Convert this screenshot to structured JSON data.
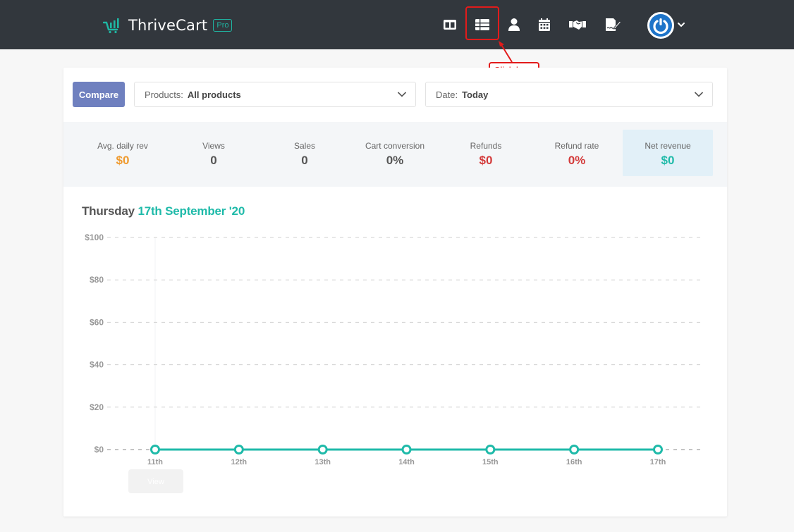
{
  "header": {
    "brand": "ThriveCart",
    "badge": "Pro",
    "nav_icons": [
      "columns-icon",
      "table-icon",
      "user-icon",
      "calendar-icon",
      "handshake-icon",
      "signature-icon"
    ],
    "colors": {
      "background": "#32373d",
      "accent": "#1fb6a3",
      "highlight": "#e21b1b"
    }
  },
  "callout": {
    "text": "Click here"
  },
  "filters": {
    "compare_label": "Compare",
    "products_label": "Products:",
    "products_value": "All products",
    "date_label": "Date:",
    "date_value": "Today"
  },
  "stats": [
    {
      "label": "Avg. daily rev",
      "value": "$0",
      "color": "#ef9a2e"
    },
    {
      "label": "Views",
      "value": "0",
      "color": "#555555"
    },
    {
      "label": "Sales",
      "value": "0",
      "color": "#555555"
    },
    {
      "label": "Cart conversion",
      "value": "0%",
      "color": "#555555"
    },
    {
      "label": "Refunds",
      "value": "$0",
      "color": "#d33a3a"
    },
    {
      "label": "Refund rate",
      "value": "0%",
      "color": "#d33a3a"
    },
    {
      "label": "Net revenue",
      "value": "$0",
      "color": "#1fbaa9"
    }
  ],
  "chart_title": {
    "day": "Thursday",
    "date": "17th September '20"
  },
  "chart_data": {
    "type": "line",
    "categories": [
      "11th",
      "12th",
      "13th",
      "14th",
      "15th",
      "16th",
      "17th"
    ],
    "y_ticks": [
      "$100",
      "$80",
      "$60",
      "$40",
      "$20",
      "$0"
    ],
    "series": [
      {
        "values": [
          0,
          0,
          0,
          0,
          0,
          0,
          0
        ],
        "color": "#1fbaa9"
      }
    ],
    "ylim": [
      0,
      100
    ],
    "grid": true
  },
  "tooltip": {
    "label": "View"
  }
}
